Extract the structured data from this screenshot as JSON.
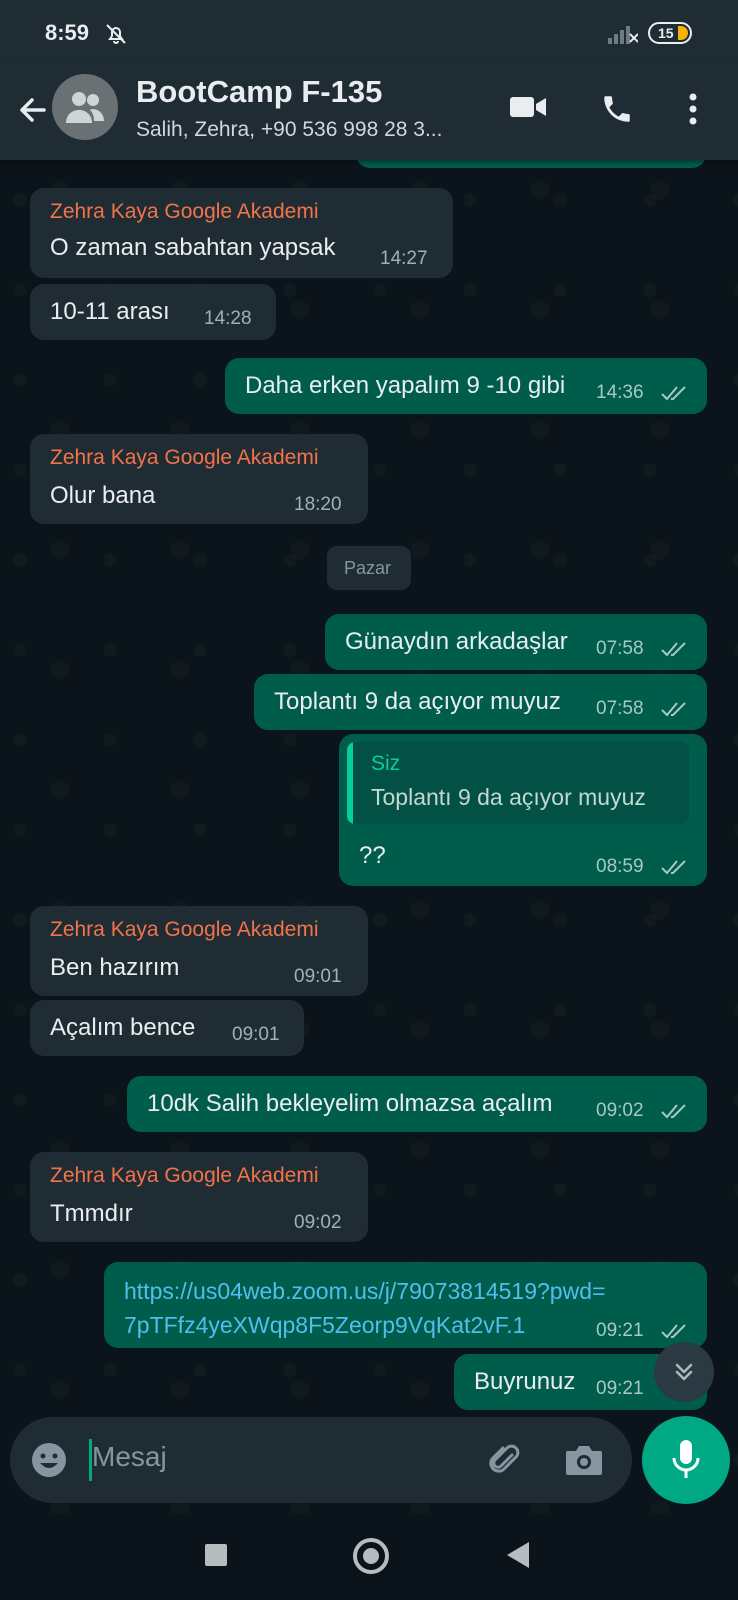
{
  "status_bar": {
    "time": "8:59",
    "battery": "15"
  },
  "header": {
    "title": "BootCamp F-135",
    "subtitle": "Salih, Zehra, +90 536 998 28 3..."
  },
  "messages": [
    {
      "sender": "Zehra Kaya Google Akademi",
      "text": "O zaman sabahtan yapsak",
      "time": "14:27"
    },
    {
      "text": "10-11 arası",
      "time": "14:28"
    },
    {
      "text": "Daha erken yapalım 9 -10 gibi",
      "time": "14:36"
    },
    {
      "sender": "Zehra Kaya Google Akademi",
      "text": "Olur bana",
      "time": "18:20"
    },
    {
      "text": "Günaydın arkadaşlar",
      "time": "07:58"
    },
    {
      "text": "Toplantı 9 da açıyor muyuz",
      "time": "07:58"
    },
    {
      "quote_author": "Siz",
      "quote_text": "Toplantı 9 da açıyor muyuz",
      "text": "??",
      "time": "08:59"
    },
    {
      "sender": "Zehra Kaya Google Akademi",
      "text": "Ben hazırım",
      "time": "09:01"
    },
    {
      "text": "Açalım bence",
      "time": "09:01"
    },
    {
      "text": "10dk Salih bekleyelim olmazsa açalım",
      "time": "09:02"
    },
    {
      "sender": "Zehra Kaya Google Akademi",
      "text": "Tmmdır",
      "time": "09:02"
    },
    {
      "link_line1": "https://us04web.zoom.us/j/79073814519?pwd=",
      "link_line2": "7pTFfz4yeXWqp8F5Zeorp9VqKat2vF.1",
      "time": "09:21"
    },
    {
      "text": "Buyrunuz",
      "time": "09:21"
    }
  ],
  "day_separator": "Pazar",
  "input": {
    "placeholder": "Mesaj"
  },
  "colors": {
    "accent": "#00a884",
    "outgoing": "#005c4b",
    "incoming": "#202c33",
    "sender_name": "#f2734a",
    "link": "#53bdeb"
  },
  "icons": [
    "back-arrow-icon",
    "group-avatar-icon",
    "video-call-icon",
    "phone-icon",
    "more-vert-icon",
    "double-check-icon",
    "scroll-down-icon",
    "emoji-icon",
    "attach-icon",
    "camera-icon",
    "mic-icon"
  ]
}
